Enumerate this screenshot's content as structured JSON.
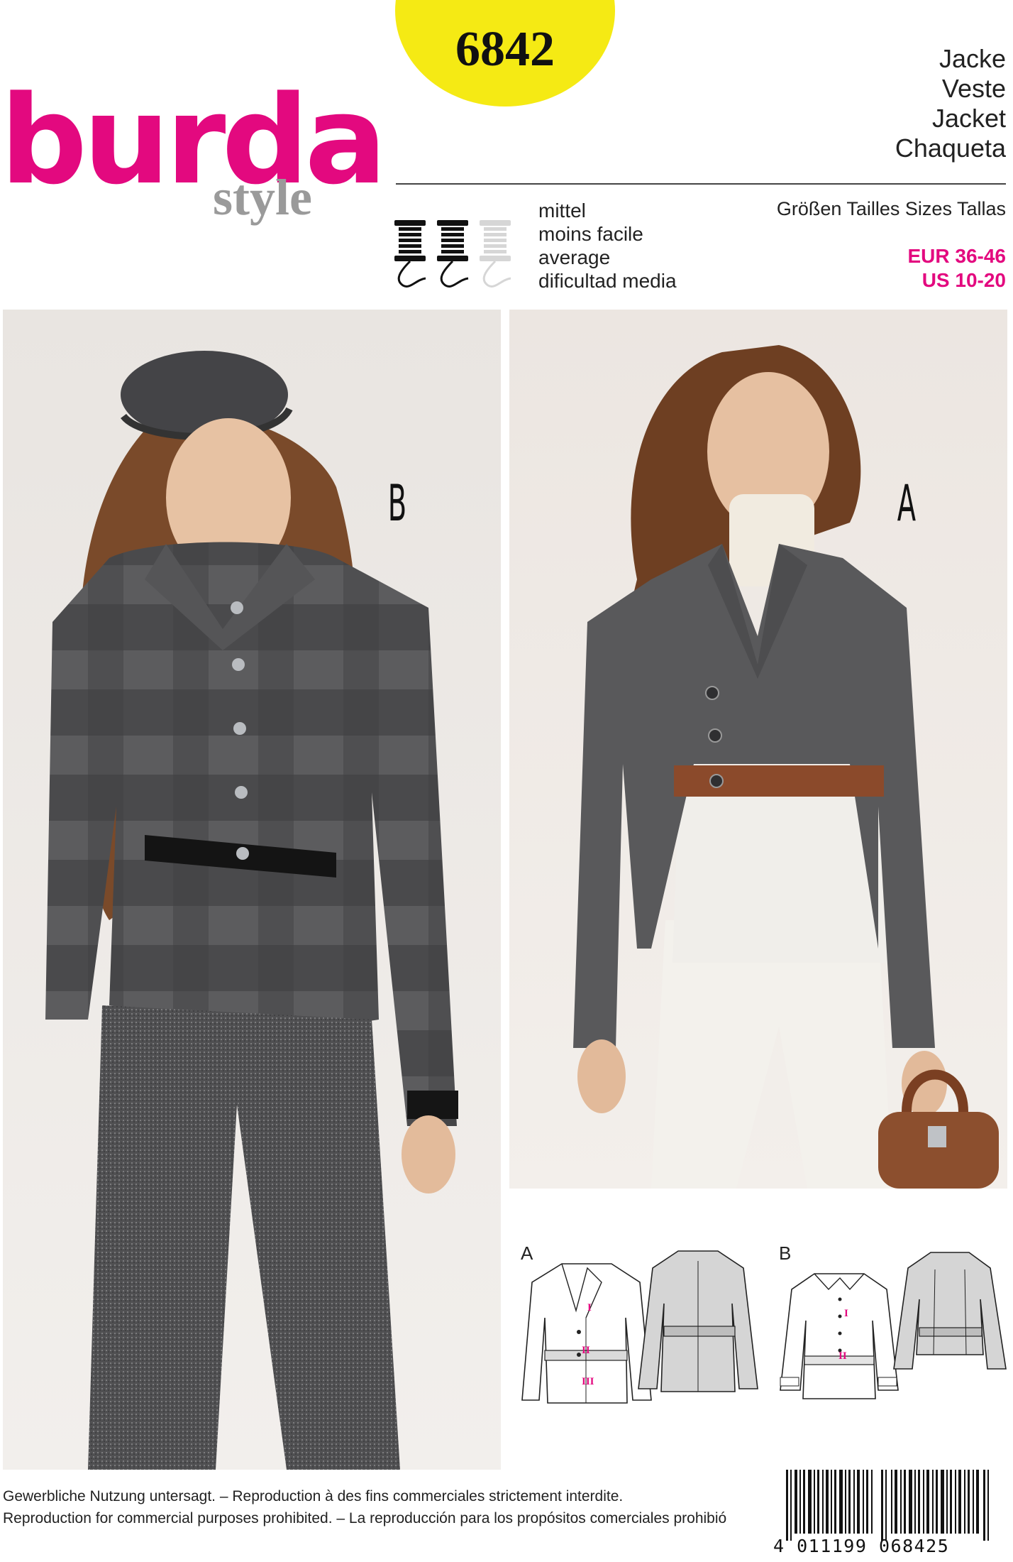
{
  "header": {
    "pattern_number": "6842",
    "brand_main": "burda",
    "brand_sub": "style",
    "garment_names": [
      "Jacke",
      "Veste",
      "Jacket",
      "Chaqueta"
    ]
  },
  "difficulty": {
    "levels": [
      "mittel",
      "moins facile",
      "average",
      "dificultad media"
    ],
    "level_count": 2,
    "level_max": 3
  },
  "sizes": {
    "label": "Größen Tailles Sizes Tallas",
    "eur": "EUR 36-46",
    "us": "US 10-20"
  },
  "views": {
    "photo_left_letter": "B",
    "photo_right_letter": "A",
    "drawing_a_letter": "A",
    "drawing_b_letter": "B",
    "piece_marks_a": [
      "I",
      "II",
      "III"
    ],
    "piece_marks_b": [
      "I",
      "II"
    ]
  },
  "footer": {
    "line1": "Gewerbliche Nutzung untersagt. – Reproduction à des fins commerciales strictement interdite.",
    "line2": "Reproduction for commercial purposes prohibited. – La reproducción para los propósitos comerciales prohibió",
    "barcode_number": "4 011199 068425"
  },
  "colors": {
    "brand_pink": "#e3097f",
    "badge_yellow": "#f5ea14",
    "logo_grey": "#9a9a9a"
  }
}
